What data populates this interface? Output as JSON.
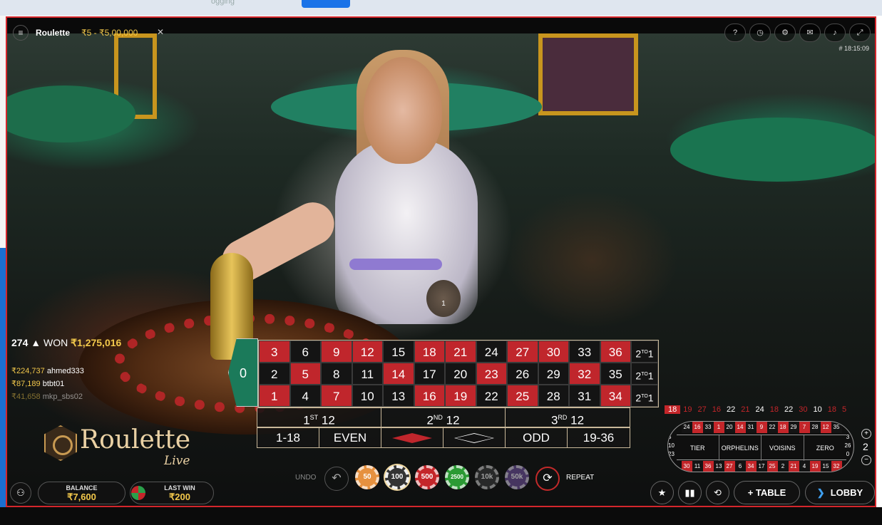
{
  "browser": {
    "top_partial_text": "ogging"
  },
  "topbar": {
    "menu_icon": "hamburger-icon",
    "title": "Roulette",
    "limits": "₹5 - ₹5,00,000",
    "close_symbol": "✕",
    "round_id": "# 18:15:09"
  },
  "top_icons": [
    "help-icon",
    "history-icon",
    "settings-icon",
    "chat-icon",
    "sound-icon",
    "fullscreen-icon"
  ],
  "players": {
    "count": "274",
    "won_label": "WON",
    "won_amount": "₹1,275,016"
  },
  "winners": [
    {
      "amount": "₹224,737",
      "name": "ahmed333"
    },
    {
      "amount": "₹87,189",
      "name": "btbt01"
    },
    {
      "amount": "₹41,658",
      "name": "mkp_sbs02"
    }
  ],
  "logo": {
    "word": "Roulette",
    "sub": "Live"
  },
  "table": {
    "zero": "0",
    "rows": [
      [
        {
          "n": "3",
          "c": "red"
        },
        {
          "n": "6",
          "c": "black"
        },
        {
          "n": "9",
          "c": "red"
        },
        {
          "n": "12",
          "c": "red"
        },
        {
          "n": "15",
          "c": "black"
        },
        {
          "n": "18",
          "c": "red"
        },
        {
          "n": "21",
          "c": "red"
        },
        {
          "n": "24",
          "c": "black"
        },
        {
          "n": "27",
          "c": "red"
        },
        {
          "n": "30",
          "c": "red"
        },
        {
          "n": "33",
          "c": "black"
        },
        {
          "n": "36",
          "c": "red"
        }
      ],
      [
        {
          "n": "2",
          "c": "black"
        },
        {
          "n": "5",
          "c": "red"
        },
        {
          "n": "8",
          "c": "black"
        },
        {
          "n": "11",
          "c": "black"
        },
        {
          "n": "14",
          "c": "red"
        },
        {
          "n": "17",
          "c": "black"
        },
        {
          "n": "20",
          "c": "black"
        },
        {
          "n": "23",
          "c": "red"
        },
        {
          "n": "26",
          "c": "black"
        },
        {
          "n": "29",
          "c": "black"
        },
        {
          "n": "32",
          "c": "red"
        },
        {
          "n": "35",
          "c": "black"
        }
      ],
      [
        {
          "n": "1",
          "c": "red"
        },
        {
          "n": "4",
          "c": "black"
        },
        {
          "n": "7",
          "c": "red"
        },
        {
          "n": "10",
          "c": "black"
        },
        {
          "n": "13",
          "c": "black"
        },
        {
          "n": "16",
          "c": "red"
        },
        {
          "n": "19",
          "c": "red"
        },
        {
          "n": "22",
          "c": "black"
        },
        {
          "n": "25",
          "c": "red"
        },
        {
          "n": "28",
          "c": "black"
        },
        {
          "n": "31",
          "c": "black"
        },
        {
          "n": "34",
          "c": "red"
        }
      ]
    ],
    "column_bet": {
      "main": "2",
      "sup": "TO",
      "end": "1"
    },
    "dozens": [
      {
        "main": "1",
        "sup": "ST",
        "end": " 12"
      },
      {
        "main": "2",
        "sup": "ND",
        "end": " 12"
      },
      {
        "main": "3",
        "sup": "RD",
        "end": " 12"
      }
    ],
    "outside": {
      "low": "1-18",
      "even": "EVEN",
      "odd": "ODD",
      "high": "19-36"
    }
  },
  "controls": {
    "undo": "UNDO",
    "chips": [
      "50",
      "100",
      "500",
      "2500",
      "10k",
      "50k"
    ],
    "repeat": "REPEAT"
  },
  "balance": {
    "label": "BALANCE",
    "value": "₹7,600"
  },
  "last_win": {
    "label": "LAST WIN",
    "value": "₹200"
  },
  "history": [
    {
      "n": "18",
      "c": "r"
    },
    {
      "n": "19",
      "c": "r"
    },
    {
      "n": "27",
      "c": "r"
    },
    {
      "n": "16",
      "c": "r"
    },
    {
      "n": "22",
      "c": "b"
    },
    {
      "n": "21",
      "c": "r"
    },
    {
      "n": "24",
      "c": "b"
    },
    {
      "n": "18",
      "c": "r"
    },
    {
      "n": "22",
      "c": "b"
    },
    {
      "n": "30",
      "c": "r"
    },
    {
      "n": "10",
      "c": "b"
    },
    {
      "n": "18",
      "c": "r"
    },
    {
      "n": "5",
      "c": "r"
    }
  ],
  "racetrack": {
    "top": [
      {
        "n": "24",
        "c": "b"
      },
      {
        "n": "16",
        "c": "r"
      },
      {
        "n": "33",
        "c": "b"
      },
      {
        "n": "1",
        "c": "r"
      },
      {
        "n": "20",
        "c": "b"
      },
      {
        "n": "14",
        "c": "r"
      },
      {
        "n": "31",
        "c": "b"
      },
      {
        "n": "9",
        "c": "r"
      },
      {
        "n": "22",
        "c": "b"
      },
      {
        "n": "18",
        "c": "r"
      },
      {
        "n": "29",
        "c": "b"
      },
      {
        "n": "7",
        "c": "r"
      },
      {
        "n": "28",
        "c": "b"
      },
      {
        "n": "12",
        "c": "r"
      },
      {
        "n": "35",
        "c": "b"
      }
    ],
    "bottom": [
      {
        "n": "30",
        "c": "r"
      },
      {
        "n": "11",
        "c": "b"
      },
      {
        "n": "36",
        "c": "r"
      },
      {
        "n": "13",
        "c": "b"
      },
      {
        "n": "27",
        "c": "r"
      },
      {
        "n": "6",
        "c": "b"
      },
      {
        "n": "34",
        "c": "r"
      },
      {
        "n": "17",
        "c": "b"
      },
      {
        "n": "25",
        "c": "r"
      },
      {
        "n": "2",
        "c": "b"
      },
      {
        "n": "21",
        "c": "r"
      },
      {
        "n": "4",
        "c": "b"
      },
      {
        "n": "19",
        "c": "r"
      },
      {
        "n": "15",
        "c": "b"
      },
      {
        "n": "32",
        "c": "r"
      }
    ],
    "left": [
      "5",
      "10",
      "23",
      "8"
    ],
    "right": [
      "3",
      "26",
      "0"
    ],
    "sections": [
      "TIER",
      "ORPHELINS",
      "VOISINS",
      "ZERO"
    ],
    "neighbours": "2"
  },
  "buttons": {
    "table": "TABLE",
    "lobby": "LOBBY"
  },
  "colors": {
    "red": "#c0262c",
    "black": "#141414",
    "green": "#1b7a5a",
    "gold": "#f2c84b",
    "frame": "#d4262c"
  }
}
